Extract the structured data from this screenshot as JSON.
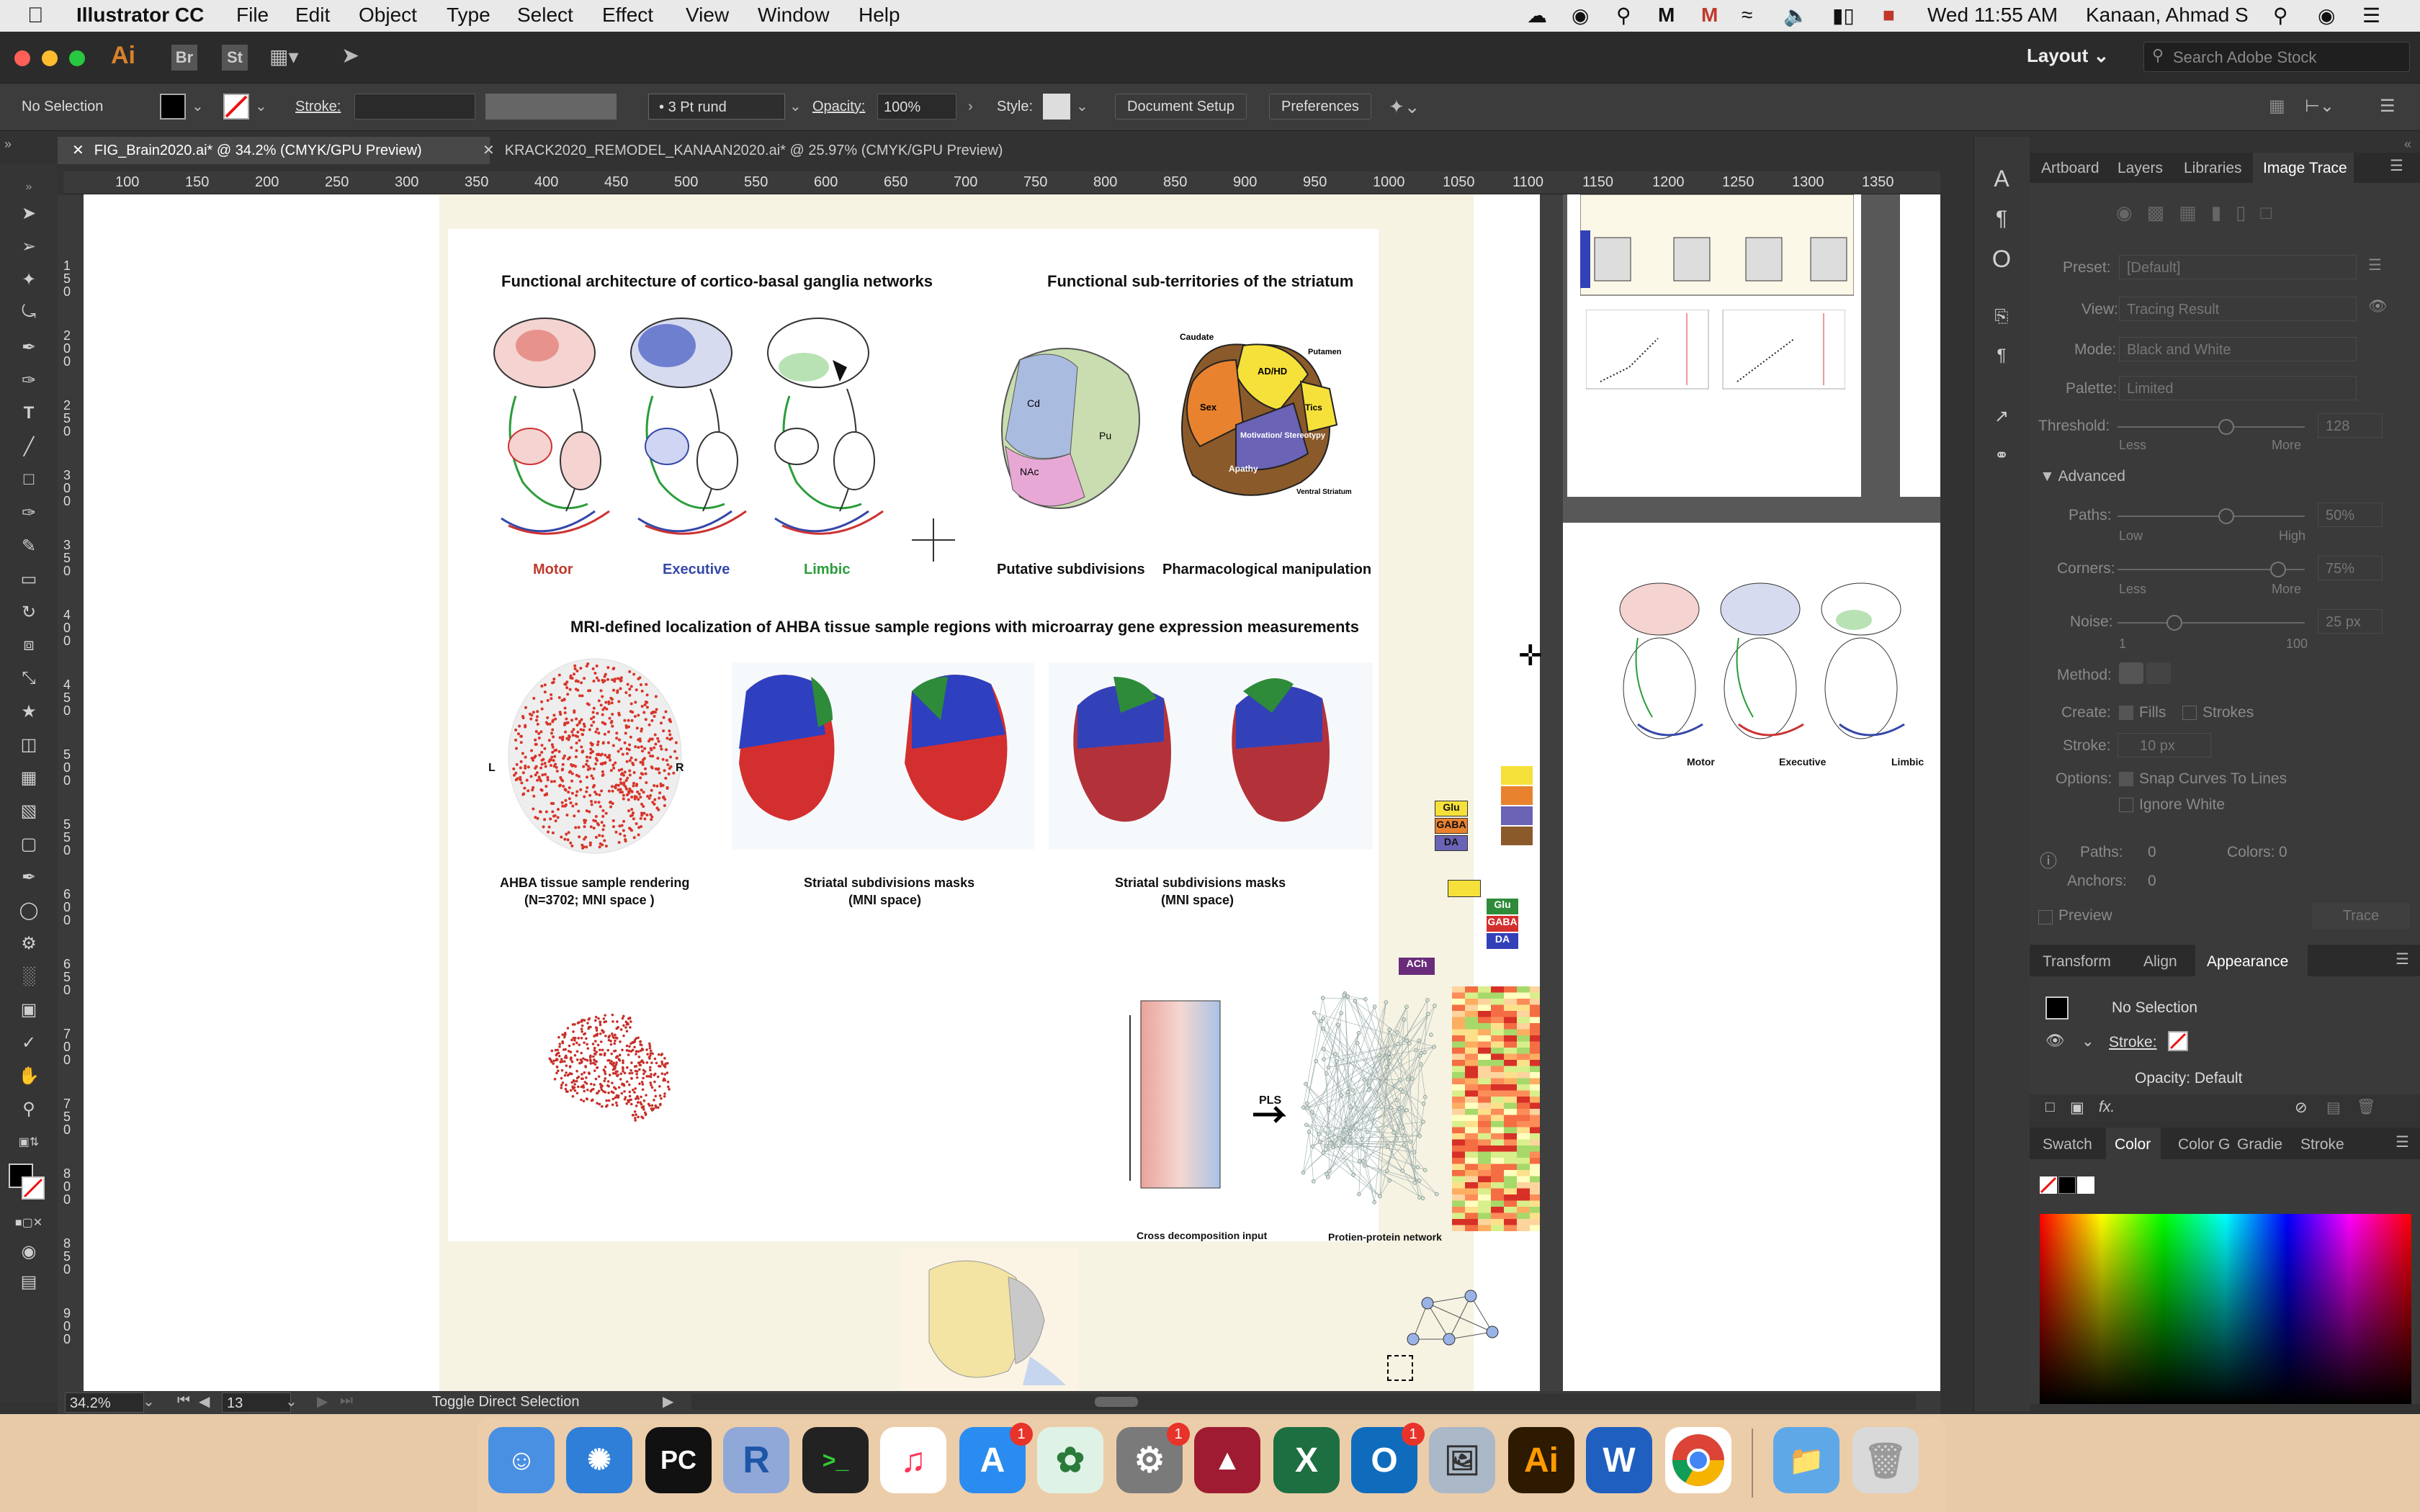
{
  "menubar": {
    "app_name": "Illustrator CC",
    "items": [
      "File",
      "Edit",
      "Object",
      "Type",
      "Select",
      "Effect",
      "View",
      "Window",
      "Help"
    ],
    "datetime": "Wed 11:55 AM",
    "user": "Kanaan, Ahmad S"
  },
  "titlebar": {
    "ai_logo": "Ai",
    "br": "Br",
    "st": "St",
    "workspace": "Layout",
    "search_placeholder": "Search Adobe Stock"
  },
  "control": {
    "selection": "No Selection",
    "stroke_label": "Stroke:",
    "brush": "3 Pt rund",
    "opacity_label": "Opacity:",
    "opacity_value": "100%",
    "style_label": "Style:",
    "document_setup": "Document Setup",
    "preferences": "Preferences"
  },
  "tabs": [
    {
      "label": "FIG_Brain2020.ai* @ 34.2% (CMYK/GPU Preview)",
      "close": "✕"
    },
    {
      "label": "KRACK2020_REMODEL_KANAAN2020.ai* @ 25.97% (CMYK/GPU Preview)",
      "close": "✕"
    }
  ],
  "ruler_h": [
    "100",
    "150",
    "200",
    "250",
    "300",
    "350",
    "400",
    "450",
    "500",
    "550",
    "600",
    "650",
    "700",
    "750",
    "800",
    "850",
    "900",
    "950",
    "1000",
    "1050",
    "1100",
    "1150",
    "1200",
    "1250",
    "1300",
    "1350"
  ],
  "ruler_v": [
    "1 5 0",
    "2 0 0",
    "2 5 0",
    "3 0 0",
    "3 5 0",
    "4 0 0",
    "4 5 0",
    "5 0 0",
    "5 5 0",
    "6 0 0",
    "6 5 0",
    "7 0 0",
    "7 5 0",
    "8 0 0",
    "8 5 0",
    "9 0 0"
  ],
  "status": {
    "zoom": "34.2%",
    "page": "13",
    "hint": "Toggle Direct Selection"
  },
  "artwork": {
    "title1": "Functional architecture of cortico-basal ganglia networks",
    "title2": "Functional sub-territories of the striatum",
    "motor": "Motor",
    "executive": "Executive",
    "limbic": "Limbic",
    "putative": "Putative subdivisions",
    "pharma": "Pharmacological manipulation",
    "mri_title": "MRI-defined localization of AHBA tissue sample regions with microarray gene expression measurements",
    "ahba1": "AHBA tissue sample rendering",
    "ahba2": "(N=3702; MNI space )",
    "str1": "Striatal subdivisions masks",
    "str2": "(MNI space)",
    "str3": "Striatal subdivisions masks",
    "str4": "(MNI space)",
    "cross": "Cross decomposition input",
    "ppi": "Protien-protein network",
    "pls": "PLS",
    "glu": "Glu",
    "gaba": "GABA",
    "da": "DA",
    "ach": "ACh",
    "caudate": "Caudate",
    "putamen": "Putamen",
    "adhd": "AD/HD",
    "sex": "Sex",
    "tics": "Tics",
    "motivation": "Motivation/ Stereotypy",
    "apathy": "Apathy",
    "ventral": "Ventral Striatum",
    "cd": "Cd",
    "pu": "Pu",
    "nac": "NAc",
    "L": "L",
    "R": "R"
  },
  "right_artboard": {
    "motor": "Motor",
    "executive": "Executive",
    "limbic": "Limbic"
  },
  "panel_tabs": [
    "Artboard",
    "Layers",
    "Libraries",
    "Image Trace"
  ],
  "image_trace": {
    "preset_label": "Preset:",
    "preset_value": "[Default]",
    "view_label": "View:",
    "view_value": "Tracing Result",
    "mode_label": "Mode:",
    "mode_value": "Black and White",
    "palette_label": "Palette:",
    "palette_value": "Limited",
    "threshold_label": "Threshold:",
    "threshold_value": "128",
    "less": "Less",
    "more": "More",
    "advanced": "Advanced",
    "paths_label": "Paths:",
    "paths_value": "50%",
    "low": "Low",
    "high": "High",
    "corners_label": "Corners:",
    "corners_value": "75%",
    "less2": "Less",
    "more2": "More",
    "noise_label": "Noise:",
    "noise_value": "25 px",
    "noise_min": "1",
    "noise_max": "100",
    "method_label": "Method:",
    "create_label": "Create:",
    "fills": "Fills",
    "strokes": "Strokes",
    "stroke_label": "Stroke:",
    "stroke_value": "10 px",
    "options_label": "Options:",
    "snap": "Snap Curves To Lines",
    "ignore": "Ignore White",
    "paths_count_label": "Paths:",
    "paths_count": "0",
    "colors_label": "Colors:",
    "colors_count": "0",
    "anchors_label": "Anchors:",
    "anchors_count": "0",
    "preview": "Preview",
    "trace": "Trace"
  },
  "appearance_tabs": [
    "Transform",
    "Align",
    "Appearance"
  ],
  "appearance": {
    "no_selection": "No Selection",
    "stroke": "Stroke:",
    "opacity": "Opacity: Default",
    "fx": "fx."
  },
  "color_tabs": [
    "Swatch",
    "Color",
    "Color G",
    "Gradie",
    "Stroke"
  ],
  "dock": {
    "pycharm": "PC",
    "r": "R",
    "illustrator": "Ai",
    "word": "W",
    "excel": "X",
    "outlook": "O",
    "appstore_badge": "1",
    "prefs_badge": "1",
    "outlook_badge": "1"
  }
}
